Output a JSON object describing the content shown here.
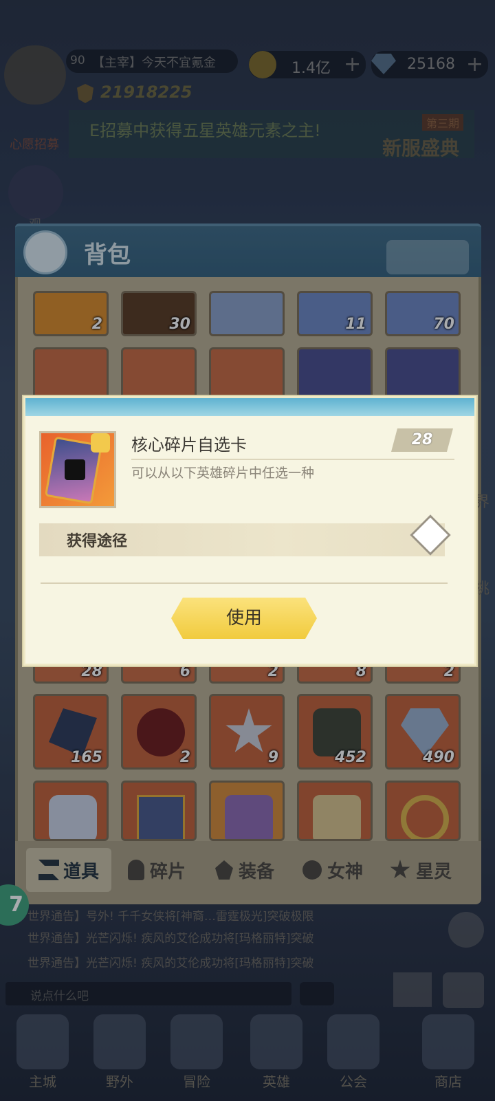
{
  "top": {
    "level": "90",
    "player_name": "【主宰】今天不宜氪金",
    "gold": "1.4亿",
    "diamonds": "25168",
    "power": "21918225",
    "banner_text": "E招募中获得五星英雄元素之主!",
    "event_tag": "第三期",
    "event_title": "新服盛典",
    "wish_label": "心愿招募",
    "side_label": "观"
  },
  "bag": {
    "title": "背包",
    "row1_counts": [
      "2",
      "30",
      "",
      "11",
      "70"
    ],
    "row3_counts": [
      "28",
      "6",
      "2",
      "8",
      "2"
    ],
    "row4_counts": [
      "165",
      "2",
      "9",
      "452",
      "490"
    ],
    "tabs": [
      "道具",
      "碎片",
      "装备",
      "女神",
      "星灵"
    ]
  },
  "popup": {
    "item_name": "核心碎片自选卡",
    "count": "28",
    "description": "可以从以下英雄碎片中任选一种",
    "source_label": "获得途径",
    "use_button": "使用"
  },
  "chat": {
    "lines": [
      "世界通告】号外!  千千女侠将[神裔…雷霆极光]突破极限",
      "世界通告】光芒闪烁!  疾风的艾伦成功将[玛格丽特]突破",
      "世界通告】光芒闪烁!  疾风的艾伦成功将[玛格丽特]突破"
    ],
    "input_placeholder": "说点什么吧",
    "badge": "7"
  },
  "nav": {
    "items": [
      "主城",
      "野外",
      "冒险",
      "英雄",
      "公会",
      "商店"
    ]
  },
  "right_edge": {
    "label1": "界",
    "label2": "挑"
  },
  "colors": {
    "header_blue": "#3f6a85",
    "popup_bg": "#f7f5e2",
    "button_yellow": "#f1cb3e",
    "count_gray": "#c8c1a7"
  }
}
